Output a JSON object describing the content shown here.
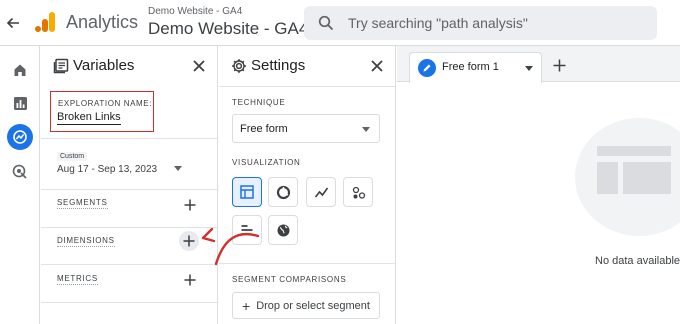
{
  "header": {
    "app_name": "Analytics",
    "account_sub": "Demo Website - GA4",
    "property_name": "Demo Website - GA4",
    "search_placeholder": "Try searching \"path analysis\""
  },
  "rail": {
    "items": [
      "home-icon",
      "reports-icon",
      "explore-icon",
      "advertising-icon"
    ],
    "active": "explore-icon"
  },
  "variables": {
    "title": "Variables",
    "exploration_label": "EXPLORATION NAME:",
    "exploration_value": "Broken Links",
    "date_chip": "Custom",
    "date_range": "Aug 17 - Sep 13, 2023",
    "segments_label": "SEGMENTS",
    "dimensions_label": "DIMENSIONS",
    "metrics_label": "METRICS"
  },
  "settings": {
    "title": "Settings",
    "technique_label": "TECHNIQUE",
    "technique_value": "Free form",
    "visualization_label": "VISUALIZATION",
    "segment_comparisons_label": "SEGMENT COMPARISONS",
    "segment_drop": "Drop or select segment"
  },
  "tabs": {
    "active_tab": "Free form 1",
    "no_data": "No data available"
  },
  "colors": {
    "accent": "#1a73e8",
    "annotation": "#d32f2f",
    "logo_orange": "#f9ab00",
    "logo_dark": "#e37400"
  }
}
